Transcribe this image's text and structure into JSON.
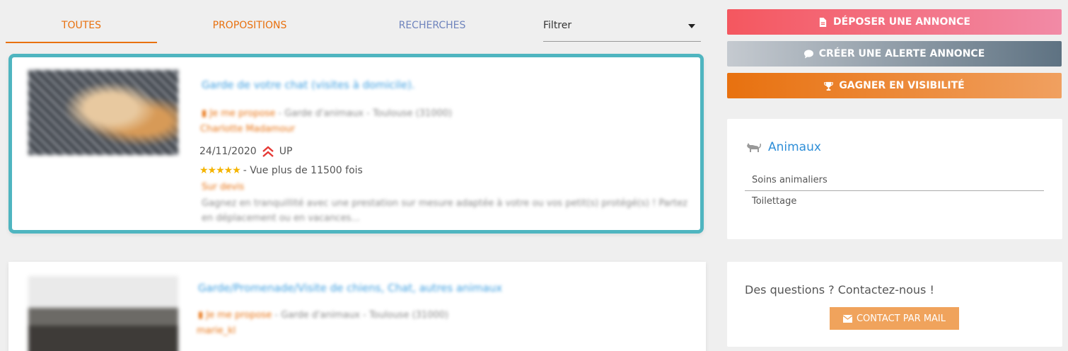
{
  "tabs": {
    "all": "TOUTES",
    "proposals": "PROPOSITIONS",
    "searches": "RECHERCHES",
    "filter_value": "Filtrer"
  },
  "listings": [
    {
      "title": "Garde de votre chat (visites à domicile).",
      "type": "Je me propose",
      "category": " - Garde d'animaux - Toulouse (31000)",
      "author": "Charlotte Madamour",
      "date": "24/11/2020",
      "up_label": "UP",
      "stars": "★★★★★",
      "views": "- Vue plus de 11500 fois",
      "price": "Sur devis",
      "description": "Gagnez en tranquillité avec une prestation sur mesure adaptée à votre ou vos petit(s) protégé(s) ! Partez en déplacement ou en vacances..."
    },
    {
      "title": "Garde/Promenade/Visite de chiens, Chat, autres animaux",
      "type": "Je me propose",
      "category": " - Garde d'animaux - Toulouse (31000)",
      "author": "marie_kl"
    }
  ],
  "actions": {
    "post_ad": "DÉPOSER UNE ANNONCE",
    "create_alert": "CRÉER UNE ALERTE ANNONCE",
    "visibility": "GAGNER EN VISIBILITÉ"
  },
  "category_panel": {
    "title": "Animaux",
    "items": [
      "Soins animaliers",
      "Toilettage"
    ]
  },
  "contact": {
    "text": "Des questions ? Contactez-nous !",
    "button": "CONTACT PAR MAIL"
  },
  "colors": {
    "accent_orange": "#e8710f",
    "link_blue": "#3a9de0",
    "card_highlight": "#4fb5c0"
  }
}
